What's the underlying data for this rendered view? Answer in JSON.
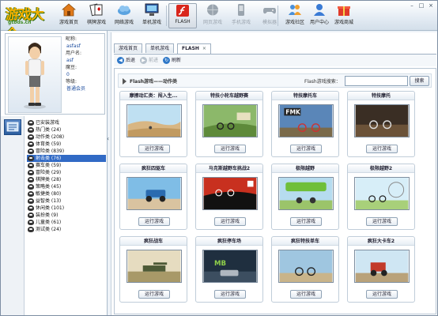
{
  "app": {
    "logo_text": "游戏大全",
    "logo_sub": "gtbds.cn"
  },
  "toolbar": [
    {
      "label": "游戏首页",
      "icon": "home-icon"
    },
    {
      "label": "棋牌游戏",
      "icon": "cards-icon"
    },
    {
      "label": "网络游戏",
      "icon": "cloud-icon"
    },
    {
      "label": "单机游戏",
      "icon": "monitor-icon"
    },
    {
      "label": "FLASH",
      "icon": "flash-icon"
    },
    {
      "label": "网页游戏",
      "icon": "globe-icon"
    },
    {
      "label": "手机游戏",
      "icon": "phone-icon"
    },
    {
      "label": "模拟器",
      "icon": "gamepad-icon"
    },
    {
      "label": "游戏社区",
      "icon": "community-icon"
    },
    {
      "label": "用户中心",
      "icon": "user-icon"
    },
    {
      "label": "游戏商城",
      "icon": "gift-icon"
    }
  ],
  "user": {
    "nick_label": "昵称:",
    "nick": "asfasf",
    "user_label": "用户名:",
    "username": "asf",
    "coin_label": "魔豆:",
    "coin": "0",
    "level_label": "等级:",
    "level": "普通会员"
  },
  "categories": [
    {
      "label": "已安装游戏"
    },
    {
      "label": "热门类 (24)"
    },
    {
      "label": "动作类 (208)"
    },
    {
      "label": "体育类 (59)"
    },
    {
      "label": "冒险类 (839)"
    },
    {
      "label": "射击类 (76)"
    },
    {
      "label": "赛车类 (59)"
    },
    {
      "label": "冒险类 (29)"
    },
    {
      "label": "棋牌类 (28)"
    },
    {
      "label": "策略类 (45)"
    },
    {
      "label": "敏捷类 (80)"
    },
    {
      "label": "益智类 (13)"
    },
    {
      "label": "休闲类 (101)"
    },
    {
      "label": "装扮类 (9)"
    },
    {
      "label": "儿童类 (61)"
    },
    {
      "label": "测试类 (24)"
    }
  ],
  "tabs": [
    {
      "label": "游戏首页"
    },
    {
      "label": "单机游戏"
    },
    {
      "label": "FLASH",
      "close": "×"
    }
  ],
  "nav": {
    "back": "后退",
    "forward": "前进",
    "refresh": "刷新"
  },
  "content": {
    "title": "Flash游戏——动作类",
    "search_label": "Flash游戏搜索：",
    "search_value": "",
    "search_button": "搜索"
  },
  "games": [
    {
      "title": "摩擦动汇类：闯入生...",
      "button": "运行游戏"
    },
    {
      "title": "特技小轮车越野赛",
      "button": "运行游戏"
    },
    {
      "title": "特技摩托车",
      "button": "运行游戏"
    },
    {
      "title": "特技摩托",
      "button": "运行游戏"
    },
    {
      "title": "疯狂四驱车",
      "button": "运行游戏"
    },
    {
      "title": "马克斯越野车挑战2",
      "button": "运行游戏"
    },
    {
      "title": "极限越野",
      "button": "运行游戏"
    },
    {
      "title": "极限越野2",
      "button": "运行游戏"
    },
    {
      "title": "疯狂战车",
      "button": "运行游戏"
    },
    {
      "title": "疯狂停车场",
      "button": "运行游戏"
    },
    {
      "title": "疯狂特技单车",
      "button": "运行游戏"
    },
    {
      "title": "疯狂大卡车2",
      "button": "运行游戏"
    }
  ],
  "colors": {
    "accent": "#316ac5",
    "flash_red": "#d9261c",
    "toolbar_bg": "#e3ebf3"
  }
}
